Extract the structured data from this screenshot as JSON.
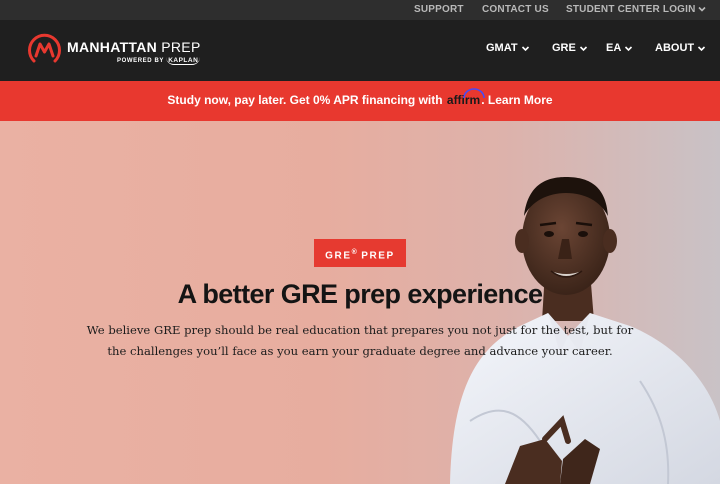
{
  "utility_bar": {
    "support": "SUPPORT",
    "contact": "CONTACT US",
    "student_login": "STUDENT CENTER LOGIN"
  },
  "logo": {
    "brand_bold": "MANHATTAN",
    "brand_thin": " PREP",
    "powered_by": "POWERED BY",
    "parent": "KAPLAN"
  },
  "nav": {
    "items": [
      {
        "label": "GMAT"
      },
      {
        "label": "GRE"
      },
      {
        "label": "EA"
      },
      {
        "label": "ABOUT"
      }
    ]
  },
  "promo": {
    "text_before": "Study now, pay later. Get 0% APR financing with ",
    "affirm": "affirm",
    "text_after": ". ",
    "link": "Learn More"
  },
  "hero": {
    "badge_main": "GRE",
    "badge_reg": "®",
    "badge_rest": " PREP",
    "headline": "A better GRE prep experience",
    "subcopy": "We believe GRE prep should be real education that prepares you not just for the test, but for the challenges you’ll face as you earn your graduate degree and advance your career."
  },
  "colors": {
    "utility_bg": "#2e2e2e",
    "nav_bg": "#1f1f1f",
    "promo_bg": "#e8382f",
    "badge_bg": "#e63a30",
    "hero_bg": "#e8b0a2"
  },
  "icons": [
    "manhattan-prep-logo-icon",
    "chevron-down-icon",
    "affirm-arc-icon"
  ]
}
